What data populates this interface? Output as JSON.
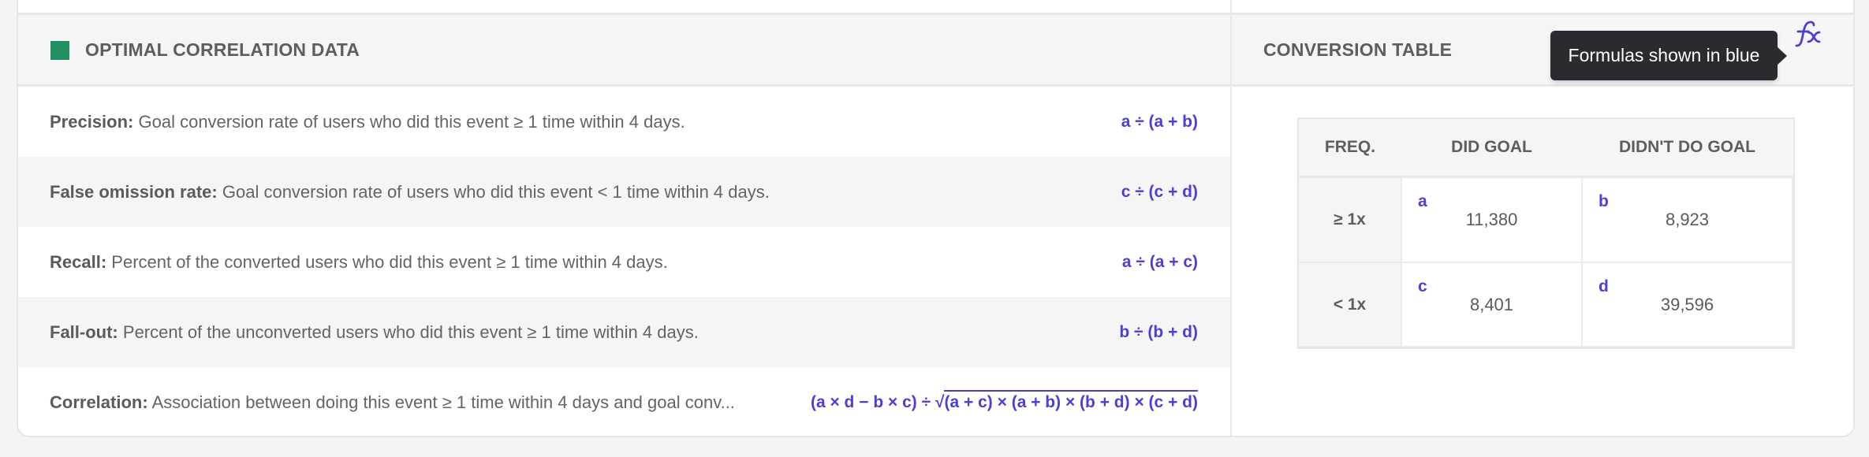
{
  "left_panel": {
    "title": "OPTIMAL CORRELATION DATA",
    "marker_color": "#219163",
    "rows": [
      {
        "term": "Precision:",
        "description": "Goal conversion rate of users who did this event ≥ 1 time within 4 days.",
        "formula": "a ÷ (a + b)"
      },
      {
        "term": "False omission rate:",
        "description": "Goal conversion rate of users who did this event < 1 time within 4 days.",
        "formula": "c ÷ (c + d)"
      },
      {
        "term": "Recall:",
        "description": "Percent of the converted users who did this event ≥ 1 time within 4 days.",
        "formula": "a ÷ (a + c)"
      },
      {
        "term": "Fall-out:",
        "description": "Percent of the unconverted users who did this event ≥ 1 time within 4 days.",
        "formula": "b ÷ (b + d)"
      },
      {
        "term": "Correlation:",
        "description": "Association between doing this event ≥ 1 time within 4 days and goal conv...",
        "formula_prefix": "(a × d − b × c) ÷ √",
        "formula_sqrt": "(a + c) × (a + b) × (b + d) × (c + d)"
      }
    ]
  },
  "right_panel": {
    "title": "CONVERSION TABLE",
    "tooltip": "Formulas shown in blue",
    "fx_icon": "function-icon",
    "formula_color": "#4b3fd6",
    "table": {
      "headers": [
        "FREQ.",
        "DID GOAL",
        "DIDN'T DO GOAL"
      ],
      "rows": [
        {
          "freq": "≥ 1x",
          "cells": [
            {
              "letter": "a",
              "value": "11,380"
            },
            {
              "letter": "b",
              "value": "8,923"
            }
          ]
        },
        {
          "freq": "< 1x",
          "cells": [
            {
              "letter": "c",
              "value": "8,401"
            },
            {
              "letter": "d",
              "value": "39,596"
            }
          ]
        }
      ]
    }
  }
}
